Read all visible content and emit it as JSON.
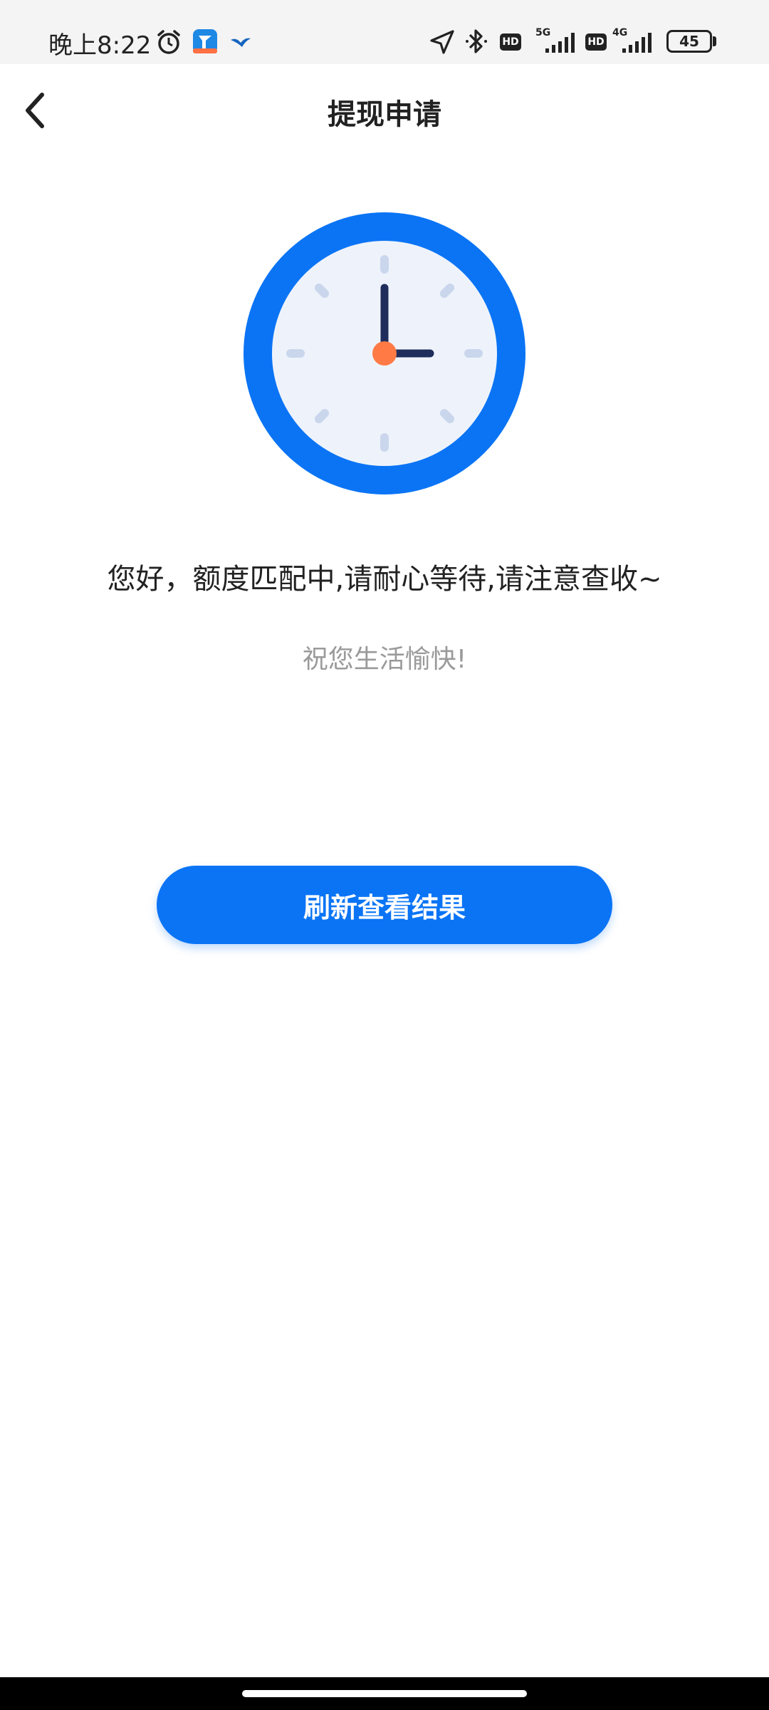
{
  "status_bar": {
    "time": "晚上8:22",
    "icons": [
      "alarm-icon",
      "app-notification-icon",
      "bird-app-icon",
      "location-icon",
      "bluetooth-icon",
      "signal-icon"
    ],
    "hd_label_1": "HD",
    "network_1": "5G",
    "hd_label_2": "HD",
    "network_2": "4G",
    "battery": "45"
  },
  "nav": {
    "title": "提现申请"
  },
  "main": {
    "illustration": "clock-icon",
    "message": "您好，额度匹配中,请耐心等待,请注意查收~",
    "sub_message": "祝您生活愉快!",
    "refresh_button_label": "刷新查看结果"
  },
  "colors": {
    "primary": "#0a74f5",
    "clock_face": "#eef3fb",
    "clock_hands": "#1f2d5c",
    "clock_center": "#ff7a45",
    "tick_marks": "#c9d6ec"
  }
}
